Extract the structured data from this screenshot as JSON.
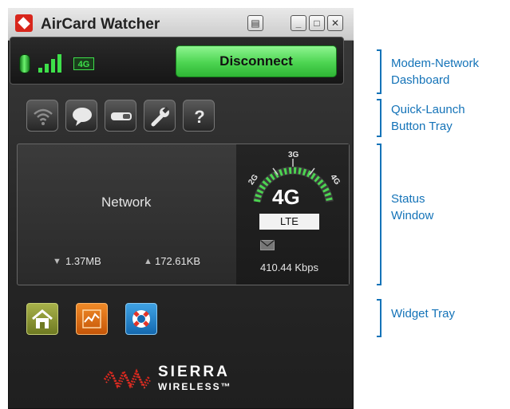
{
  "window": {
    "title": "AirCard Watcher",
    "controls": {
      "settings": "▤",
      "minimize": "_",
      "maximize": "□",
      "close": "✕"
    }
  },
  "dashboard": {
    "network_type_badge": "4G",
    "connect_button_label": "Disconnect",
    "modem_led": "green-led-icon",
    "signal_icon": "signal-strength-icon",
    "signal_bars": 4
  },
  "quick_launch": {
    "buttons": [
      {
        "icon": "wifi-icon"
      },
      {
        "icon": "chat-bubble-icon"
      },
      {
        "icon": "usb-modem-icon"
      },
      {
        "icon": "wrench-icon"
      },
      {
        "icon": "help-icon",
        "label": "?"
      }
    ]
  },
  "status": {
    "network_label": "Network",
    "download": "1.37MB",
    "upload": "172.61KB",
    "technology_scale": [
      "2G",
      "3G",
      "4G"
    ],
    "current_generation": "4G",
    "technology": "LTE",
    "speed": "410.44 Kbps"
  },
  "widget_tray": {
    "widgets": [
      {
        "icon": "home-icon"
      },
      {
        "icon": "graph-icon"
      },
      {
        "icon": "lifebuoy-icon"
      }
    ]
  },
  "brand": {
    "name": "SIERRA",
    "sub": "WIRELESS™"
  },
  "callouts": {
    "dashboard": {
      "line1": "Modem-Network",
      "line2": "Dashboard"
    },
    "quick_launch": {
      "line1": "Quick-Launch",
      "line2": "Button Tray"
    },
    "status": {
      "line1": "Status",
      "line2": "Window"
    },
    "widget": {
      "line1": "Widget Tray"
    }
  },
  "colors": {
    "accent_green": "#4cd451",
    "callout_blue": "#1473b8",
    "window_dark": "#262626",
    "brand_red": "#d8261c"
  }
}
